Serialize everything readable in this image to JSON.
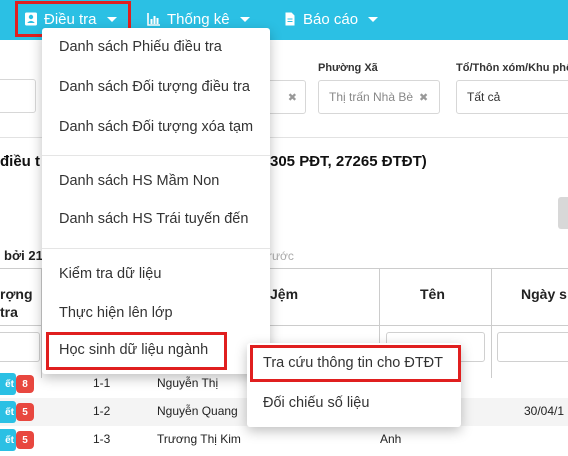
{
  "nav": {
    "items": [
      {
        "label": "Điều tra",
        "icon": "user-card-icon"
      },
      {
        "label": "Thống kê",
        "icon": "bar-chart-icon"
      },
      {
        "label": "Báo cáo",
        "icon": "document-icon"
      }
    ]
  },
  "filters": {
    "ward_label": "Phường Xã",
    "ward_value": "Thị trấn Nhà Bè",
    "hamlet_label": "Tổ/Thôn xóm/Khu phố",
    "hamlet_value": "Tất cả",
    "clear_symbol": "✖"
  },
  "summary": {
    "left_fragment": "điều t",
    "right_fragment": "305 PĐT, 27265 ĐTĐT)"
  },
  "sort": {
    "left_fragment": "bởi 21",
    "hint_fragment": "rước"
  },
  "table": {
    "headers": {
      "col1_line1": "rợng",
      "col1_line2": "tra",
      "col_lastname": "Jệm",
      "col_name": "Tên",
      "col_date": "Ngày s"
    },
    "rows": [
      {
        "action": "ết",
        "count": "8",
        "code": "1-1",
        "lastname": "Nguyễn Thị",
        "name": "",
        "date": ""
      },
      {
        "action": "ết",
        "count": "5",
        "code": "1-2",
        "lastname": "Nguyễn Quang",
        "name": "",
        "date": "30/04/1"
      },
      {
        "action": "ết",
        "count": "5",
        "code": "1-3",
        "lastname": "Trương Thị Kim",
        "name": "Anh",
        "date": ""
      }
    ]
  },
  "menu": {
    "items": [
      "Danh sách Phiếu điều tra",
      "Danh sách Đối tượng điều tra",
      "Danh sách Đối tượng xóa tạm",
      "Danh sách HS Mầm Non",
      "Danh sách HS Trái tuyến đến",
      "Kiểm tra dữ liệu",
      "Thực hiện lên lớp",
      "Học sinh dữ liệu ngành"
    ]
  },
  "submenu": {
    "items": [
      "Tra cứu thông tin cho ĐTĐT",
      "Đối chiếu số liệu"
    ]
  },
  "colors": {
    "primary": "#2bc0e4",
    "highlight_border": "#e01f1f",
    "badge": "#e8473f"
  }
}
